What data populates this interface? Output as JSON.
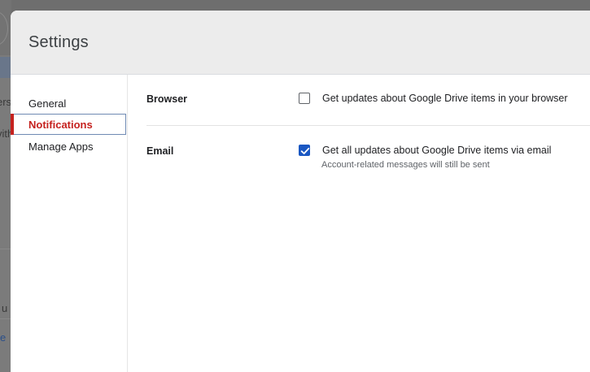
{
  "background": {
    "text_fragments": [
      "ers",
      "vith",
      "u",
      "e"
    ]
  },
  "dialog": {
    "title": "Settings"
  },
  "sidebar": {
    "items": [
      {
        "label": "General",
        "active": false
      },
      {
        "label": "Notifications",
        "active": true
      },
      {
        "label": "Manage Apps",
        "active": false
      }
    ]
  },
  "notifications": {
    "browser": {
      "label": "Browser",
      "option_text": "Get updates about Google Drive items in your browser",
      "checked": false
    },
    "email": {
      "label": "Email",
      "option_text": "Get all updates about Google Drive items via email",
      "sub_text": "Account-related messages will still be sent",
      "checked": true
    }
  },
  "colors": {
    "active_nav": "#c5221f",
    "checkbox_checked": "#1a57c2",
    "header_bg": "#ececec"
  }
}
